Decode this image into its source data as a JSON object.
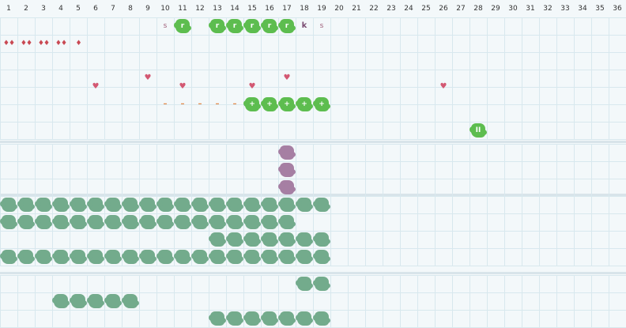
{
  "columns": [
    "1",
    "2",
    "3",
    "4",
    "5",
    "6",
    "7",
    "8",
    "9",
    "10",
    "11",
    "12",
    "13",
    "14",
    "15",
    "16",
    "17",
    "18",
    "19",
    "20",
    "21",
    "22",
    "23",
    "24",
    "25",
    "26",
    "27",
    "28",
    "29",
    "30",
    "31",
    "32",
    "33",
    "34",
    "35",
    "36"
  ],
  "colors": {
    "bright_green": "#5dbd4f",
    "muted_green": "#73ab8c",
    "purple": "#a67fa3",
    "heart": "#d35872",
    "drop": "#c94953",
    "dash": "#e48a4a",
    "text_purple": "#a0607a",
    "grid": "#d8e8ee",
    "background": "#f3f8fa"
  },
  "sections": [
    {
      "rows": 7,
      "events": [
        {
          "col": 10,
          "row": 0,
          "kind": "text",
          "style": "s",
          "label": "s"
        },
        {
          "col": 11,
          "row": 0,
          "kind": "blob",
          "style": "bright",
          "label": "r"
        },
        {
          "col": 13,
          "row": 0,
          "kind": "blob",
          "style": "bright",
          "label": "r"
        },
        {
          "col": 14,
          "row": 0,
          "kind": "blob",
          "style": "bright",
          "label": "r"
        },
        {
          "col": 15,
          "row": 0,
          "kind": "blob",
          "style": "bright",
          "label": "r"
        },
        {
          "col": 16,
          "row": 0,
          "kind": "blob",
          "style": "bright",
          "label": "r"
        },
        {
          "col": 17,
          "row": 0,
          "kind": "blob",
          "style": "bright",
          "label": "r"
        },
        {
          "col": 18,
          "row": 0,
          "kind": "text",
          "style": "k",
          "label": "k"
        },
        {
          "col": 19,
          "row": 0,
          "kind": "text",
          "style": "s",
          "label": "s"
        },
        {
          "col": 1,
          "row": 1,
          "kind": "text",
          "style": "drop",
          "label": "♦♦"
        },
        {
          "col": 2,
          "row": 1,
          "kind": "text",
          "style": "drop",
          "label": "♦♦"
        },
        {
          "col": 3,
          "row": 1,
          "kind": "text",
          "style": "drop",
          "label": "♦♦"
        },
        {
          "col": 4,
          "row": 1,
          "kind": "text",
          "style": "drop",
          "label": "♦♦"
        },
        {
          "col": 5,
          "row": 1,
          "kind": "text",
          "style": "drop",
          "label": "♦"
        },
        {
          "col": 9,
          "row": 3,
          "kind": "text",
          "style": "heart",
          "label": "♥"
        },
        {
          "col": 17,
          "row": 3,
          "kind": "text",
          "style": "heart",
          "label": "♥"
        },
        {
          "col": 6,
          "row": 3.5,
          "kind": "text",
          "style": "heart",
          "label": "♥"
        },
        {
          "col": 11,
          "row": 3.5,
          "kind": "text",
          "style": "heart",
          "label": "♥"
        },
        {
          "col": 15,
          "row": 3.5,
          "kind": "text",
          "style": "heart",
          "label": "♥"
        },
        {
          "col": 26,
          "row": 3.5,
          "kind": "text",
          "style": "heart",
          "label": "♥"
        },
        {
          "col": 10,
          "row": 4.5,
          "kind": "text",
          "style": "dash",
          "label": "–"
        },
        {
          "col": 11,
          "row": 4.5,
          "kind": "text",
          "style": "dash",
          "label": "–"
        },
        {
          "col": 12,
          "row": 4.5,
          "kind": "text",
          "style": "dash",
          "label": "–"
        },
        {
          "col": 13,
          "row": 4.5,
          "kind": "text",
          "style": "dash",
          "label": "–"
        },
        {
          "col": 14,
          "row": 4.5,
          "kind": "text",
          "style": "dash",
          "label": "–"
        },
        {
          "col": 15,
          "row": 4.5,
          "kind": "blob",
          "style": "bright",
          "label": "+"
        },
        {
          "col": 16,
          "row": 4.5,
          "kind": "blob",
          "style": "bright",
          "label": "+"
        },
        {
          "col": 17,
          "row": 4.5,
          "kind": "blob",
          "style": "bright",
          "label": "+"
        },
        {
          "col": 18,
          "row": 4.5,
          "kind": "blob",
          "style": "bright",
          "label": "+"
        },
        {
          "col": 19,
          "row": 4.5,
          "kind": "blob",
          "style": "bright",
          "label": "+"
        },
        {
          "col": 28,
          "row": 6,
          "kind": "blob",
          "style": "bright",
          "label": "II"
        }
      ]
    },
    {
      "rows": 3,
      "events": [
        {
          "col": 17,
          "row": 0,
          "kind": "blob",
          "style": "purple",
          "label": ""
        },
        {
          "col": 17,
          "row": 1,
          "kind": "blob",
          "style": "purple",
          "label": ""
        },
        {
          "col": 17,
          "row": 2,
          "kind": "blob",
          "style": "purple",
          "label": ""
        }
      ]
    },
    {
      "rows": 4,
      "runs": [
        {
          "row": 0,
          "from": 1,
          "to": 19,
          "style": "muted"
        },
        {
          "row": 1,
          "from": 1,
          "to": 17,
          "style": "muted"
        },
        {
          "row": 2,
          "from": 13,
          "to": 19,
          "style": "muted"
        },
        {
          "row": 3,
          "from": 1,
          "to": 19,
          "style": "muted"
        }
      ]
    },
    {
      "rows": 3,
      "runs": [
        {
          "row": 0,
          "from": 18,
          "to": 19,
          "style": "muted"
        },
        {
          "row": 1,
          "from": 4,
          "to": 8,
          "style": "muted"
        },
        {
          "row": 2,
          "from": 13,
          "to": 19,
          "style": "muted"
        }
      ]
    }
  ]
}
